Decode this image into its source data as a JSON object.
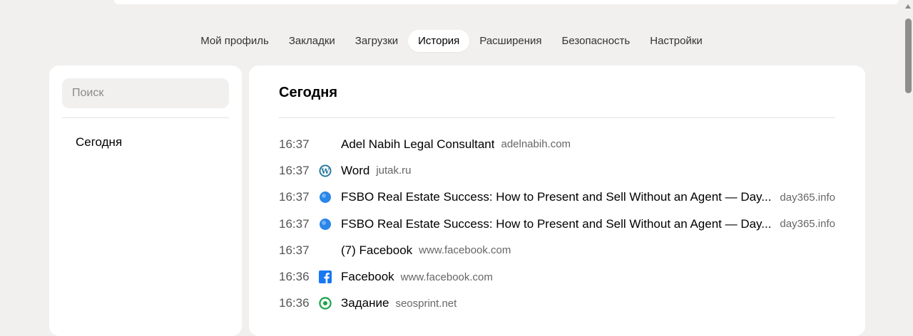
{
  "tabs": [
    {
      "label": "Мой профиль",
      "active": false
    },
    {
      "label": "Закладки",
      "active": false
    },
    {
      "label": "Загрузки",
      "active": false
    },
    {
      "label": "История",
      "active": true
    },
    {
      "label": "Расширения",
      "active": false
    },
    {
      "label": "Безопасность",
      "active": false
    },
    {
      "label": "Настройки",
      "active": false
    }
  ],
  "sidebar": {
    "search_placeholder": "Поиск",
    "items": [
      {
        "label": "Сегодня"
      }
    ]
  },
  "main": {
    "section_title": "Сегодня",
    "history": [
      {
        "time": "16:37",
        "title": "Adel Nabih Legal Consultant",
        "domain": "adelnabih.com",
        "icon": "none"
      },
      {
        "time": "16:37",
        "title": "Word",
        "domain": "jutak.ru",
        "icon": "wordpress-icon"
      },
      {
        "time": "16:37",
        "title": "FSBO Real Estate Success: How to Present and Sell Without an Agent — Day...",
        "domain": "day365.info",
        "icon": "blue-circle-icon"
      },
      {
        "time": "16:37",
        "title": "FSBO Real Estate Success: How to Present and Sell Without an Agent — Day...",
        "domain": "day365.info",
        "icon": "blue-circle-icon"
      },
      {
        "time": "16:37",
        "title": "(7) Facebook",
        "domain": "www.facebook.com",
        "icon": "none"
      },
      {
        "time": "16:36",
        "title": "Facebook",
        "domain": "www.facebook.com",
        "icon": "facebook-icon"
      },
      {
        "time": "16:36",
        "title": "Задание",
        "domain": "seosprint.net",
        "icon": "seosprint-icon"
      }
    ]
  },
  "colors": {
    "background": "#f1f0ee",
    "panel": "#ffffff",
    "wordpress": "#21759b",
    "facebook": "#1877f2",
    "blue_circle": "#2a86e8",
    "seosprint": "#1aa34a"
  }
}
